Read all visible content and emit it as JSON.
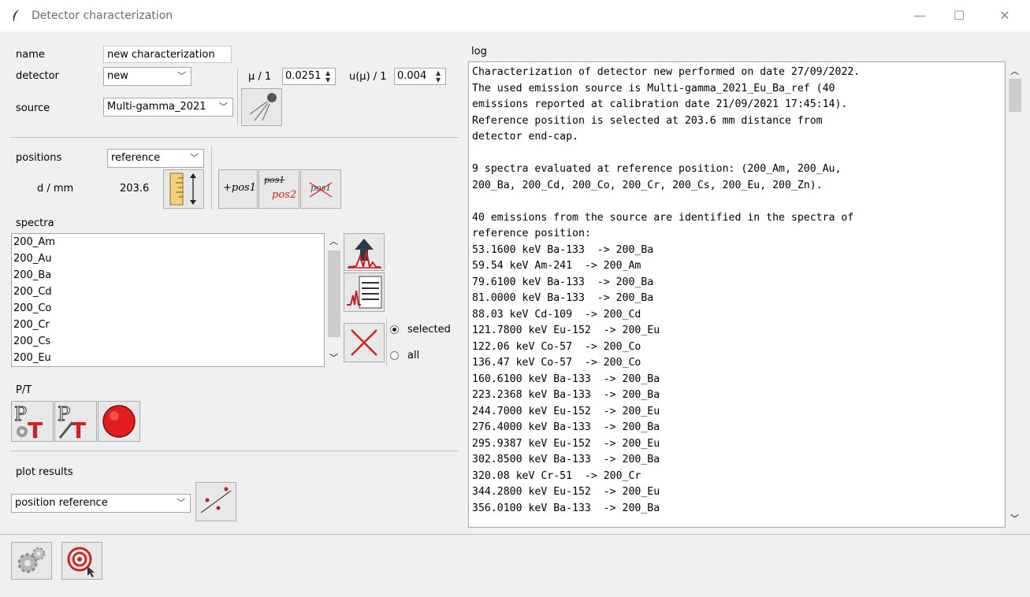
{
  "window": {
    "title": "Detector characterization"
  },
  "form": {
    "name_label": "name",
    "name_value": "new characterization",
    "detector_label": "detector",
    "detector_value": "new",
    "source_label": "source",
    "source_value": "Multi-gamma_2021",
    "mu_label": "μ / 1",
    "mu_value": "0.0251",
    "umu_label": "u(μ) / 1",
    "umu_value": "0.004"
  },
  "positions": {
    "label": "positions",
    "value": "reference",
    "distance_label": "d / mm",
    "distance_value": "203.6",
    "add_pos_label": "+pos1",
    "swap_pos_top": "pos1",
    "swap_pos_bottom": "pos2",
    "remove_pos_label": "pos1"
  },
  "spectra": {
    "label": "spectra",
    "items": [
      "200_Am",
      "200_Au",
      "200_Ba",
      "200_Cd",
      "200_Co",
      "200_Cr",
      "200_Cs",
      "200_Eu"
    ],
    "radio_selected": "selected",
    "radio_all": "all",
    "selected_mode": "selected"
  },
  "pt": {
    "label": "P/T"
  },
  "plot": {
    "label": "plot results",
    "value": "position reference"
  },
  "log": {
    "label": "log",
    "lines": [
      "Characterization of detector new performed on date 27/09/2022.",
      "The used emission source is Multi-gamma_2021_Eu_Ba_ref (40",
      "emissions reported at calibration date 21/09/2021 17:45:14).",
      "Reference position is selected at 203.6 mm distance from",
      "detector end-cap.",
      "",
      "9 spectra evaluated at reference position: (200_Am, 200_Au,",
      "200_Ba, 200_Cd, 200_Co, 200_Cr, 200_Cs, 200_Eu, 200_Zn).",
      "",
      "40 emissions from the source are identified in the spectra of",
      "reference position:",
      "53.1600 keV Ba-133  -> 200_Ba",
      "59.54 keV Am-241  -> 200_Am",
      "79.6100 keV Ba-133  -> 200_Ba",
      "81.0000 keV Ba-133  -> 200_Ba",
      "88.03 keV Cd-109  -> 200_Cd",
      "121.7800 keV Eu-152  -> 200_Eu",
      "122.06 keV Co-57  -> 200_Co",
      "136.47 keV Co-57  -> 200_Co",
      "160.6100 keV Ba-133  -> 200_Ba",
      "223.2368 keV Ba-133  -> 200_Ba",
      "244.7000 keV Eu-152  -> 200_Eu",
      "276.4000 keV Ba-133  -> 200_Ba",
      "295.9387 keV Eu-152  -> 200_Eu",
      "302.8500 keV Ba-133  -> 200_Ba",
      "320.08 keV Cr-51  -> 200_Cr",
      "344.2800 keV Eu-152  -> 200_Eu",
      "356.0100 keV Ba-133  -> 200_Ba"
    ]
  },
  "colors": {
    "accent_red": "#d42020",
    "title_text": "#6b6b6b"
  },
  "icons": [
    "feather-icon",
    "minimize-icon",
    "maximize-icon",
    "close-icon",
    "source-emission-icon",
    "ruler-icon",
    "spectrum-upload-icon",
    "spectrum-list-icon",
    "delete-x-icon",
    "pt-settings-icon",
    "pt-edit-icon",
    "record-icon",
    "scatter-plot-icon",
    "gears-icon",
    "target-icon"
  ]
}
